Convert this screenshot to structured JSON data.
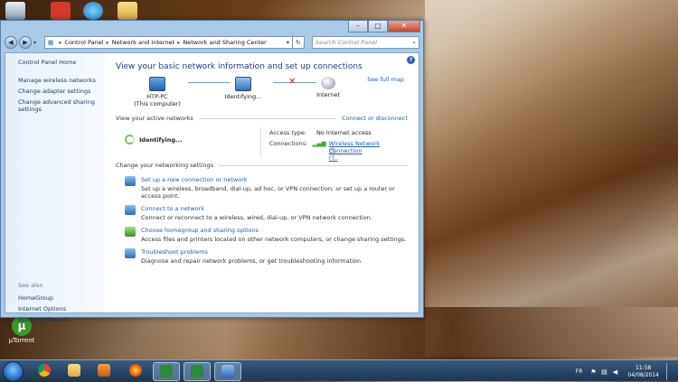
{
  "window": {
    "controls": {
      "minimize": "–",
      "maximize": "□",
      "close": "✕"
    },
    "breadcrumb": [
      "Control Panel",
      "Network and Internet",
      "Network and Sharing Center"
    ],
    "search_placeholder": "Search Control Panel"
  },
  "sidebar": {
    "home": "Control Panel Home",
    "items": [
      "Manage wireless networks",
      "Change adapter settings",
      "Change advanced sharing settings"
    ],
    "see_also_label": "See also",
    "see_also": [
      "HomeGroup",
      "Internet Options",
      "Windows Firewall"
    ]
  },
  "main": {
    "title": "View your basic network information and set up connections",
    "see_full_map": "See full map",
    "nodes": [
      {
        "label": "HTP-PC",
        "sub": "(This computer)"
      },
      {
        "label": "Identifying...",
        "sub": ""
      },
      {
        "label": "Internet",
        "sub": ""
      }
    ],
    "active_networks_header": "View your active networks",
    "connect_disconnect": "Connect or disconnect",
    "identifying": "Identifying...",
    "access_type_label": "Access type:",
    "access_type_value": "No Internet access",
    "connections_label": "Connections:",
    "connections_value": "Wireless Network Connection",
    "connections_value2": "(T..",
    "settings_header": "Change your networking settings",
    "tasks": [
      {
        "title": "Set up a new connection or network",
        "desc": "Set up a wireless, broadband, dial-up, ad hoc, or VPN connection; or set up a router or access point."
      },
      {
        "title": "Connect to a network",
        "desc": "Connect or reconnect to a wireless, wired, dial-up, or VPN network connection."
      },
      {
        "title": "Choose homegroup and sharing options",
        "desc": "Access files and printers located on other network computers, or change sharing settings."
      },
      {
        "title": "Troubleshoot problems",
        "desc": "Diagnose and repair network problems, or get troubleshooting information."
      }
    ]
  },
  "desktop": {
    "utorrent_label": "µTorrent"
  },
  "taskbar": {
    "language": "FR",
    "time": "11:58",
    "date": "04/08/2014"
  },
  "colors": {
    "link": "#1f5fb0",
    "title": "#1e3e87",
    "error": "#d9251b"
  }
}
